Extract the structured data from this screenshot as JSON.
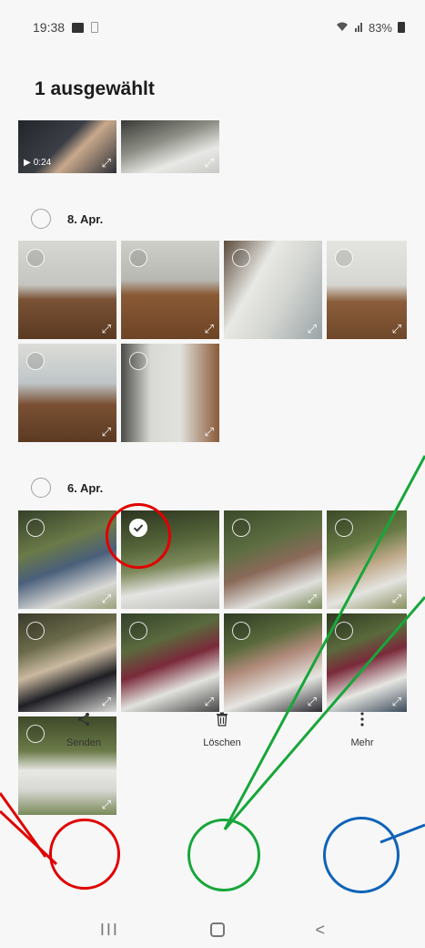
{
  "status_bar": {
    "time": "19:38",
    "battery": "83%"
  },
  "header": {
    "title": "1 ausgewählt"
  },
  "groups": [
    {
      "date": "8. Apr."
    },
    {
      "date": "6. Apr."
    }
  ],
  "top_video": {
    "duration": "0:24"
  },
  "actions": {
    "send_label": "Senden",
    "delete_label": "Löschen",
    "more_label": "Mehr"
  },
  "nav": {
    "recents": "III",
    "back": "<"
  },
  "annotation_colors": {
    "red": "#e00000",
    "green": "#17a63a",
    "blue": "#0f63b8"
  }
}
